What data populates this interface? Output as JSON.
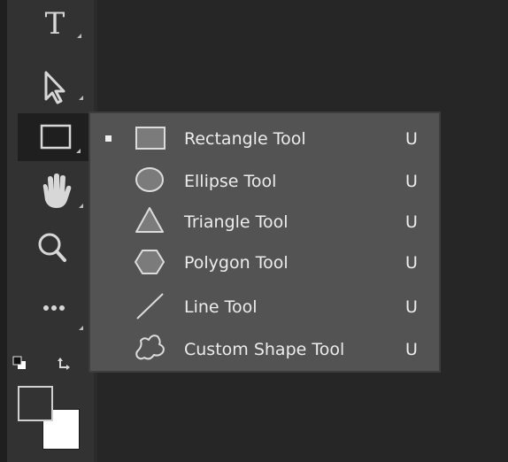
{
  "toolbar": {
    "tools": [
      {
        "name": "type-tool",
        "icon": "type-icon",
        "glyph": "T"
      },
      {
        "name": "path-selection-tool",
        "icon": "arrow-pointer-icon"
      },
      {
        "name": "rectangle-tool",
        "icon": "rectangle-icon",
        "active": true
      },
      {
        "name": "hand-tool",
        "icon": "hand-icon"
      },
      {
        "name": "zoom-tool",
        "icon": "magnifier-icon"
      },
      {
        "name": "edit-toolbar",
        "icon": "more-icon",
        "glyph": "•••"
      }
    ],
    "colors": {
      "foreground": "#333333",
      "background": "#ffffff"
    }
  },
  "flyout": {
    "items": [
      {
        "label": "Rectangle Tool",
        "shortcut": "U",
        "icon": "rectangle-icon",
        "selected": true
      },
      {
        "label": "Ellipse Tool",
        "shortcut": "U",
        "icon": "ellipse-icon"
      },
      {
        "label": "Triangle Tool",
        "shortcut": "U",
        "icon": "triangle-icon"
      },
      {
        "label": "Polygon Tool",
        "shortcut": "U",
        "icon": "polygon-icon"
      },
      {
        "label": "Line Tool",
        "shortcut": "U",
        "icon": "line-icon"
      },
      {
        "label": "Custom Shape Tool",
        "shortcut": "U",
        "icon": "custom-shape-icon"
      }
    ]
  },
  "theme": {
    "toolbar_bg": "#323232",
    "menu_bg": "#535353",
    "canvas_bg": "#262626",
    "text": "#ececec"
  }
}
